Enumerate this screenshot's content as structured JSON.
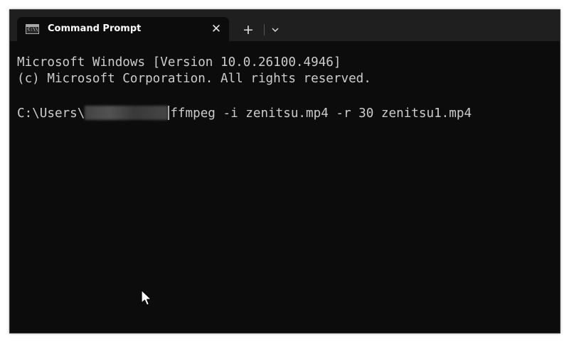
{
  "window": {
    "tab_title": "Command Prompt",
    "tab_icon": "cmd-icon",
    "tab_icon_prompt": "C:\\\\",
    "close_glyph": "✕",
    "new_tab_glyph": "+",
    "dropdown_icon": "chevron-down-icon"
  },
  "console": {
    "line1": "Microsoft Windows [Version 10.0.26100.4946]",
    "line2": "(c) Microsoft Corporation. All rights reserved.",
    "prompt_prefix": "C:\\Users\\",
    "command": "ffmpeg -i zenitsu.mp4 -r 30 zenitsu1.mp4"
  },
  "colors": {
    "background": "#0c0c0c",
    "titlebar": "#1f1f1f",
    "text": "#cccccc"
  }
}
